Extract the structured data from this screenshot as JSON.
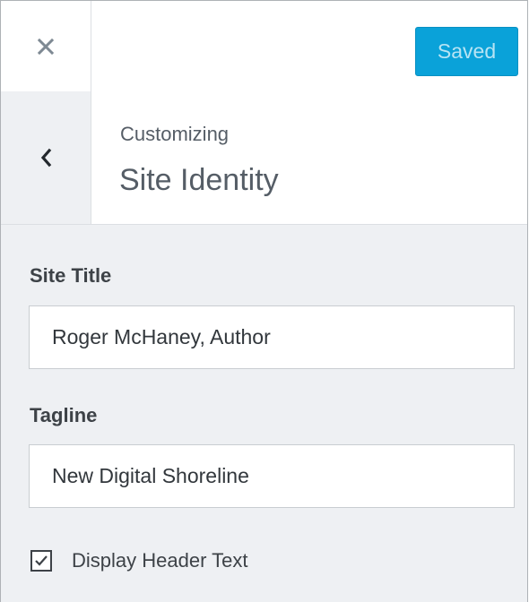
{
  "toolbar": {
    "close_icon": "close-icon",
    "save_label": "Saved",
    "save_color": "#0aa2d9"
  },
  "section": {
    "back_icon": "chevron-left-icon",
    "breadcrumb": "Customizing",
    "title": "Site Identity"
  },
  "controls": {
    "site_title": {
      "label": "Site Title",
      "value": "Roger McHaney, Author"
    },
    "tagline": {
      "label": "Tagline",
      "value": "New Digital Shoreline"
    },
    "display_header_text": {
      "label": "Display Header Text",
      "checked": true
    }
  }
}
